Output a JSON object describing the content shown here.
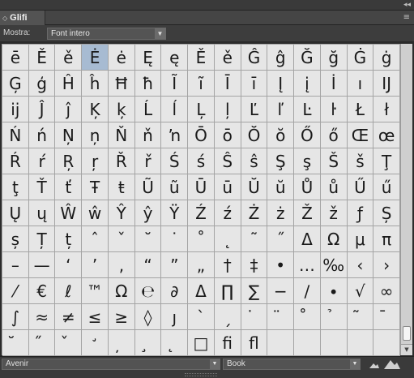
{
  "panel": {
    "collapse_glyph": "◂◂",
    "tab_icon": "◇",
    "tab_label": "Glifi",
    "menu_glyph": "≡"
  },
  "toolbar": {
    "show_label": "Mostra:",
    "show_value": "Font intero",
    "dropdown_glyph": "▼"
  },
  "glyphs": [
    "ē",
    "Ě",
    "ě",
    "Ė",
    "ė",
    "Ę",
    "ę",
    "Ě",
    "ě",
    "Ĝ",
    "ĝ",
    "Ğ",
    "ğ",
    "Ġ",
    "ġ",
    "Ģ",
    "ģ",
    "Ĥ",
    "ĥ",
    "Ħ",
    "ħ",
    "Ĩ",
    "ĩ",
    "Ī",
    "ī",
    "Į",
    "į",
    "İ",
    "ı",
    "Ĳ",
    "ĳ",
    "Ĵ",
    "ĵ",
    "Ķ",
    "ķ",
    "Ĺ",
    "ĺ",
    "Ļ",
    "ļ",
    "Ľ",
    "ľ",
    "Ŀ",
    "ŀ",
    "Ł",
    "ł",
    "Ń",
    "ń",
    "Ņ",
    "ņ",
    "Ň",
    "ň",
    "ŉ",
    "Ō",
    "ō",
    "Ŏ",
    "ŏ",
    "Ő",
    "ő",
    "Œ",
    "œ",
    "Ŕ",
    "ŕ",
    "Ŗ",
    "ŗ",
    "Ř",
    "ř",
    "Ś",
    "ś",
    "Ŝ",
    "ŝ",
    "Ş",
    "ş",
    "Š",
    "š",
    "Ţ",
    "ţ",
    "Ť",
    "ť",
    "Ŧ",
    "ŧ",
    "Ũ",
    "ũ",
    "Ū",
    "ū",
    "Ŭ",
    "ŭ",
    "Ů",
    "ů",
    "Ű",
    "ű",
    "Ų",
    "ų",
    "Ŵ",
    "ŵ",
    "Ŷ",
    "ŷ",
    "Ÿ",
    "Ź",
    "ź",
    "Ż",
    "ż",
    "Ž",
    "ž",
    "ƒ",
    "Ș",
    "ș",
    "Ț",
    "ț",
    "ˆ",
    "ˇ",
    "˘",
    "˙",
    "˚",
    "˛",
    "˜",
    "˝",
    "Δ",
    "Ω",
    "μ",
    "π",
    "–",
    "—",
    "‘",
    "’",
    "‚",
    "“",
    "”",
    "„",
    "†",
    "‡",
    "•",
    "…",
    "‰",
    "‹",
    "›",
    "⁄",
    "€",
    "ℓ",
    "™",
    "Ω",
    "℮",
    "∂",
    "Δ",
    "∏",
    "∑",
    "−",
    "∕",
    "∙",
    "√",
    "∞",
    "∫",
    "≈",
    "≠",
    "≤",
    "≥",
    "◊",
    "ȷ",
    "ˋ",
    "ˏ",
    "̇",
    "̈",
    "̊",
    "̉",
    "̃",
    "̄",
    "̆",
    "̋",
    "̌",
    "̛",
    "̦",
    "̧",
    "̨",
    "□",
    "ﬁ",
    "ﬂ",
    "",
    "",
    "",
    "",
    ""
  ],
  "selected_index": 3,
  "bottom": {
    "font_family": "Avenir",
    "font_style": "Book",
    "dropdown_glyph": "▼"
  }
}
